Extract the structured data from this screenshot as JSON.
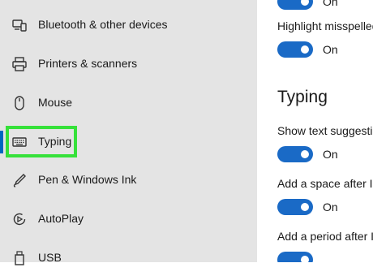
{
  "sidebar": {
    "items": [
      {
        "label": "Bluetooth & other devices",
        "icon": "bluetooth-devices-icon"
      },
      {
        "label": "Printers & scanners",
        "icon": "printer-icon"
      },
      {
        "label": "Mouse",
        "icon": "mouse-icon"
      },
      {
        "label": "Typing",
        "icon": "keyboard-icon",
        "selected": true
      },
      {
        "label": "Pen & Windows Ink",
        "icon": "pen-icon"
      },
      {
        "label": "AutoPlay",
        "icon": "autoplay-icon"
      },
      {
        "label": "USB",
        "icon": "usb-icon"
      }
    ]
  },
  "main": {
    "top_toggle_state": "On",
    "highlight_misspelled": {
      "label": "Highlight misspelled words",
      "state": "On"
    },
    "section_title": "Typing",
    "show_text_suggestions": {
      "label": "Show text suggestions as I type",
      "state": "On"
    },
    "add_space": {
      "label": "Add a space after I choose a text suggestion",
      "state": "On"
    },
    "add_period": {
      "label": "Add a period after I double-tap the Spacebar"
    }
  },
  "colors": {
    "accent": "#1a6ac6",
    "highlight": "#36e13a",
    "sidebar_bg": "#e4e4e4"
  }
}
